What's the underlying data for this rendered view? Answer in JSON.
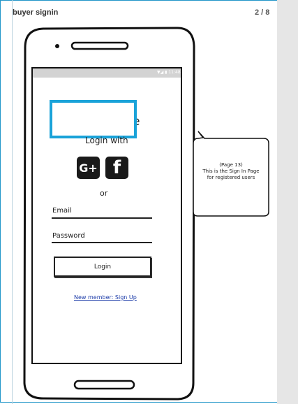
{
  "header": {
    "title": "buyer signin",
    "page_counter": "2 / 8"
  },
  "phone": {
    "status_time": "▼◢ ▮ 11:48",
    "title_partial": "e",
    "login_with": "Login with",
    "social": {
      "google_label": "G+",
      "facebook_label": "f"
    },
    "or_text": "or",
    "email_label": "Email",
    "password_label": "Password",
    "login_button": "Login",
    "signup_link": "New member: Sign Up"
  },
  "callout": {
    "line1": "(Page 13)",
    "line2": "This is the Sign In Page",
    "line3": "for registered users"
  },
  "colors": {
    "frame_border": "#2196c9",
    "highlight": "#1aa3d9",
    "link": "#1a3aa8",
    "side_panel": "#e6e6e6"
  }
}
